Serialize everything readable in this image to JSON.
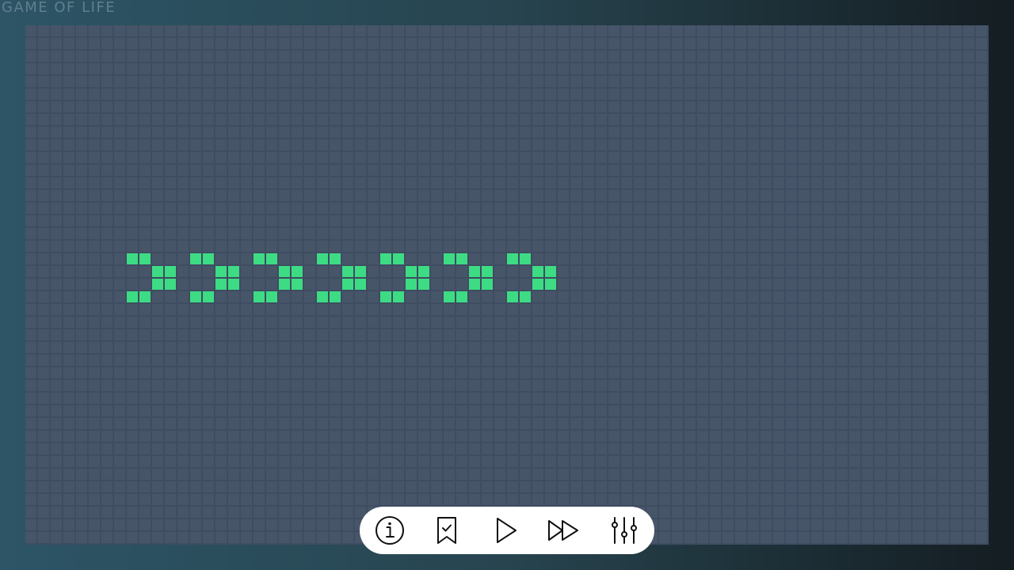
{
  "app": {
    "title": "GAME OF LIFE"
  },
  "board": {
    "cell_color": "#3ddc84",
    "background_color": "#475569",
    "live_cells": [
      [
        7,
        17
      ],
      [
        8,
        17
      ],
      [
        9,
        18
      ],
      [
        10,
        18
      ],
      [
        9,
        19
      ],
      [
        10,
        19
      ],
      [
        7,
        20
      ],
      [
        8,
        20
      ],
      [
        12,
        17
      ],
      [
        13,
        17
      ],
      [
        14,
        18
      ],
      [
        15,
        18
      ],
      [
        14,
        19
      ],
      [
        15,
        19
      ],
      [
        12,
        20
      ],
      [
        13,
        20
      ],
      [
        17,
        17
      ],
      [
        18,
        17
      ],
      [
        19,
        18
      ],
      [
        20,
        18
      ],
      [
        19,
        19
      ],
      [
        20,
        19
      ],
      [
        17,
        20
      ],
      [
        18,
        20
      ],
      [
        22,
        17
      ],
      [
        23,
        17
      ],
      [
        24,
        18
      ],
      [
        25,
        18
      ],
      [
        24,
        19
      ],
      [
        25,
        19
      ],
      [
        22,
        20
      ],
      [
        23,
        20
      ],
      [
        27,
        17
      ],
      [
        28,
        17
      ],
      [
        29,
        18
      ],
      [
        30,
        18
      ],
      [
        29,
        19
      ],
      [
        30,
        19
      ],
      [
        27,
        20
      ],
      [
        28,
        20
      ],
      [
        32,
        17
      ],
      [
        33,
        17
      ],
      [
        34,
        18
      ],
      [
        35,
        18
      ],
      [
        34,
        19
      ],
      [
        35,
        19
      ],
      [
        32,
        20
      ],
      [
        33,
        20
      ],
      [
        37,
        17
      ],
      [
        38,
        17
      ],
      [
        39,
        18
      ],
      [
        40,
        18
      ],
      [
        39,
        19
      ],
      [
        40,
        19
      ],
      [
        37,
        20
      ],
      [
        38,
        20
      ]
    ]
  },
  "toolbar": {
    "buttons": [
      {
        "name": "info-button",
        "icon": "info-icon"
      },
      {
        "name": "saved-patterns-button",
        "icon": "bookmark-check-icon"
      },
      {
        "name": "play-button",
        "icon": "play-icon"
      },
      {
        "name": "fast-forward-button",
        "icon": "fast-forward-icon"
      },
      {
        "name": "settings-button",
        "icon": "sliders-icon"
      }
    ]
  }
}
